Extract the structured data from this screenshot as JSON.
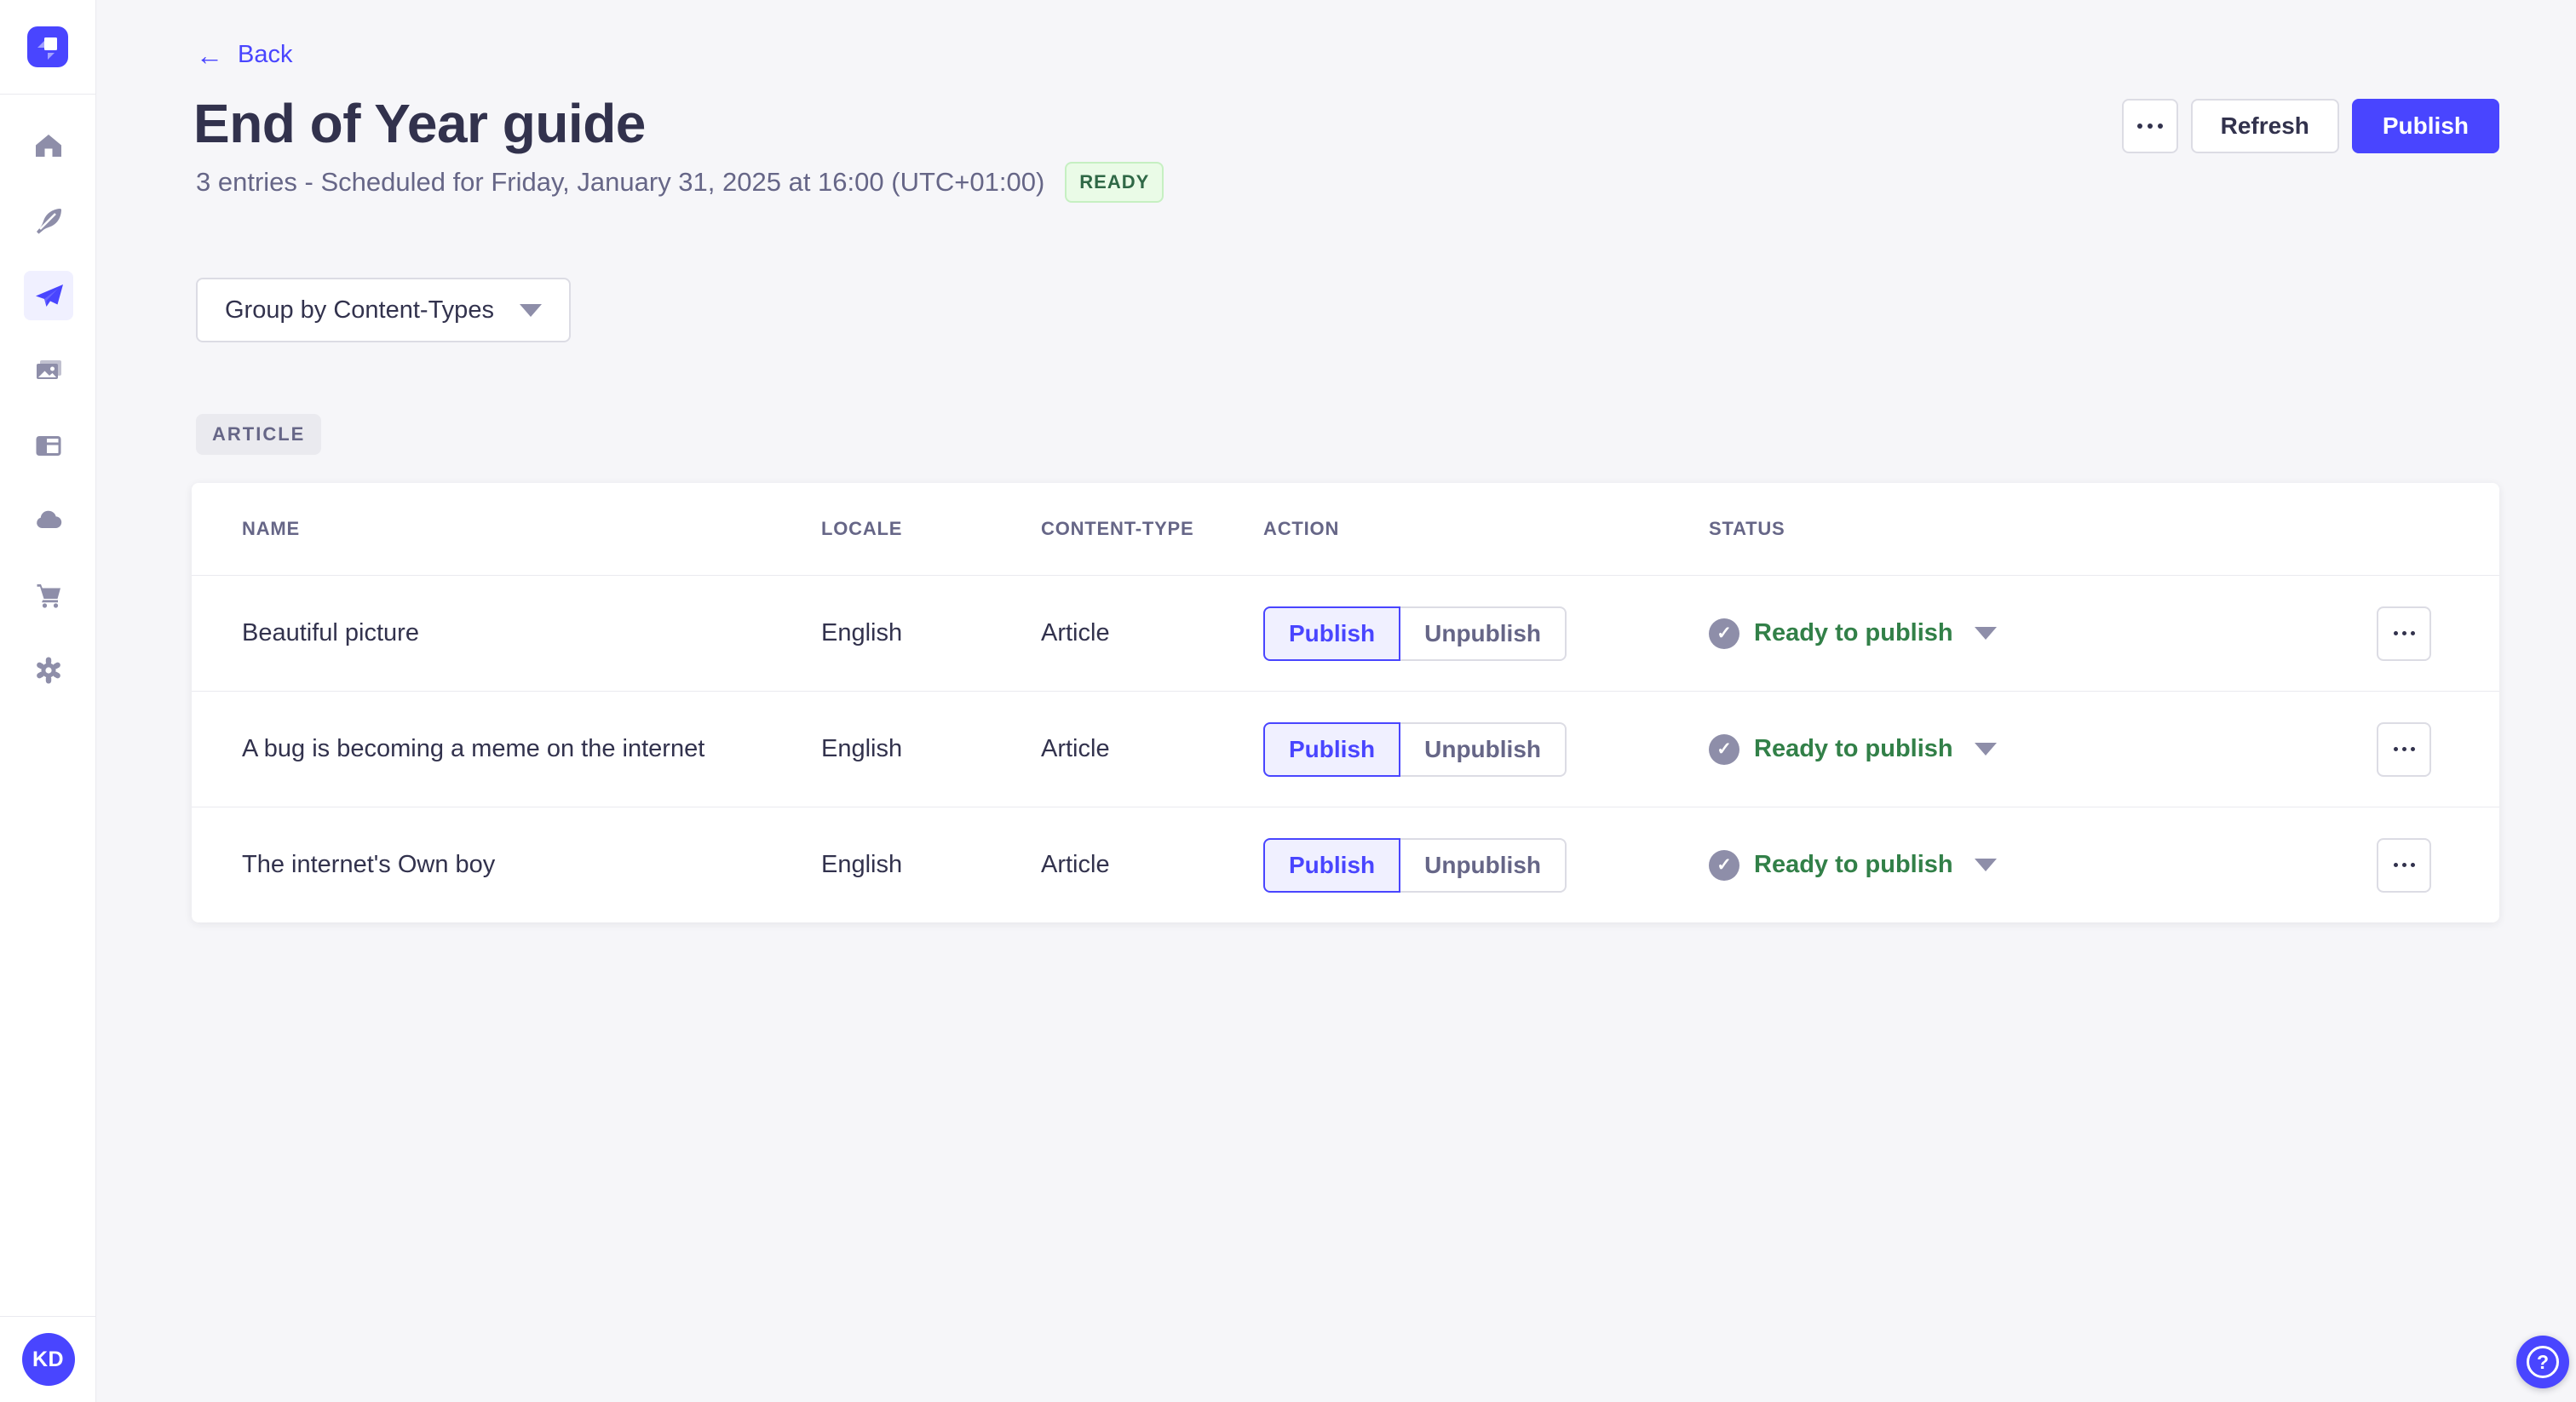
{
  "app": {
    "name": "Strapi admin",
    "accent_color": "#4945FF",
    "page_background": "#F6F6F9"
  },
  "sidebar": {
    "logo_icon": "strapi-logo",
    "items": [
      {
        "id": "home",
        "icon": "home-icon",
        "active": false
      },
      {
        "id": "content-manager",
        "icon": "feather-icon",
        "active": false
      },
      {
        "id": "releases",
        "icon": "paper-plane-icon",
        "active": true
      },
      {
        "id": "media-library",
        "icon": "pictures-icon",
        "active": false
      },
      {
        "id": "content-type-builder",
        "icon": "layout-icon",
        "active": false
      },
      {
        "id": "cloud",
        "icon": "cloud-icon",
        "active": false
      },
      {
        "id": "marketplace",
        "icon": "cart-icon",
        "active": false
      },
      {
        "id": "settings",
        "icon": "gear-icon",
        "active": false
      }
    ],
    "avatar_initials": "KD"
  },
  "header": {
    "back_label": "Back",
    "back_icon": "arrow-left-icon",
    "back_arrow": "←",
    "title": "End of Year guide",
    "subtitle": "3 entries - Scheduled for Friday, January 31, 2025 at 16:00 (UTC+01:00)",
    "status_badge": "READY",
    "status_badge_colors": {
      "bg": "#EAFBE7",
      "border": "#C6F0C2",
      "text": "#2F6846"
    },
    "more_icon": "ellipsis-icon",
    "refresh_label": "Refresh",
    "publish_label": "Publish"
  },
  "toolbar": {
    "group_by_label": "Group by Content-Types",
    "group_by_icon": "chevron-down-icon"
  },
  "group": {
    "badge": "ARTICLE"
  },
  "table": {
    "columns": [
      "NAME",
      "LOCALE",
      "CONTENT-TYPE",
      "ACTION",
      "STATUS"
    ],
    "action_labels": {
      "publish": "Publish",
      "unpublish": "Unpublish"
    },
    "status_colors": {
      "text": "#328048",
      "check_circle": "#8E8EA9"
    },
    "rows": [
      {
        "name": "Beautiful picture",
        "locale": "English",
        "content_type": "Article",
        "status": "Ready to publish",
        "status_icon": "check-circle-icon",
        "selected_action": "publish"
      },
      {
        "name": "A bug is becoming a meme on the internet",
        "locale": "English",
        "content_type": "Article",
        "status": "Ready to publish",
        "status_icon": "check-circle-icon",
        "selected_action": "publish"
      },
      {
        "name": "The internet's Own boy",
        "locale": "English",
        "content_type": "Article",
        "status": "Ready to publish",
        "status_icon": "check-circle-icon",
        "selected_action": "publish"
      }
    ]
  },
  "misc": {
    "check_glyph": "✓",
    "help_glyph": "?",
    "help_icon": "question-circle-icon"
  }
}
